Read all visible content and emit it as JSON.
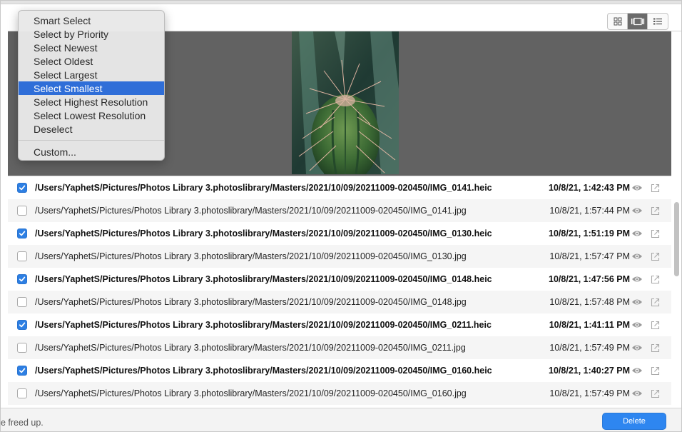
{
  "menu": {
    "items": [
      {
        "label": "Smart Select",
        "selected": false
      },
      {
        "label": "Select by Priority",
        "selected": false
      },
      {
        "label": "Select Newest",
        "selected": false
      },
      {
        "label": "Select Oldest",
        "selected": false
      },
      {
        "label": "Select Largest",
        "selected": false
      },
      {
        "label": "Select Smallest",
        "selected": true
      },
      {
        "label": "Select Highest Resolution",
        "selected": false
      },
      {
        "label": "Select Lowest Resolution",
        "selected": false
      },
      {
        "label": "Deselect",
        "selected": false
      }
    ],
    "custom_label": "Custom..."
  },
  "view_modes": [
    {
      "icon": "grid-view-icon",
      "active": false
    },
    {
      "icon": "filmstrip-view-icon",
      "active": true
    },
    {
      "icon": "list-view-icon",
      "active": false
    }
  ],
  "files": [
    {
      "path": "/Users/YaphetS/Pictures/Photos Library 3.photoslibrary/Masters/2021/10/09/20211009-020450/IMG_0141.heic",
      "date": "10/8/21, 1:42:43 PM",
      "checked": true
    },
    {
      "path": "/Users/YaphetS/Pictures/Photos Library 3.photoslibrary/Masters/2021/10/09/20211009-020450/IMG_0141.jpg",
      "date": "10/8/21, 1:57:44 PM",
      "checked": false
    },
    {
      "path": "/Users/YaphetS/Pictures/Photos Library 3.photoslibrary/Masters/2021/10/09/20211009-020450/IMG_0130.heic",
      "date": "10/8/21, 1:51:19 PM",
      "checked": true
    },
    {
      "path": "/Users/YaphetS/Pictures/Photos Library 3.photoslibrary/Masters/2021/10/09/20211009-020450/IMG_0130.jpg",
      "date": "10/8/21, 1:57:47 PM",
      "checked": false
    },
    {
      "path": "/Users/YaphetS/Pictures/Photos Library 3.photoslibrary/Masters/2021/10/09/20211009-020450/IMG_0148.heic",
      "date": "10/8/21, 1:47:56 PM",
      "checked": true
    },
    {
      "path": "/Users/YaphetS/Pictures/Photos Library 3.photoslibrary/Masters/2021/10/09/20211009-020450/IMG_0148.jpg",
      "date": "10/8/21, 1:57:48 PM",
      "checked": false
    },
    {
      "path": "/Users/YaphetS/Pictures/Photos Library 3.photoslibrary/Masters/2021/10/09/20211009-020450/IMG_0211.heic",
      "date": "10/8/21, 1:41:11 PM",
      "checked": true
    },
    {
      "path": "/Users/YaphetS/Pictures/Photos Library 3.photoslibrary/Masters/2021/10/09/20211009-020450/IMG_0211.jpg",
      "date": "10/8/21, 1:57:49 PM",
      "checked": false
    },
    {
      "path": "/Users/YaphetS/Pictures/Photos Library 3.photoslibrary/Masters/2021/10/09/20211009-020450/IMG_0160.heic",
      "date": "10/8/21, 1:40:27 PM",
      "checked": true
    },
    {
      "path": "/Users/YaphetS/Pictures/Photos Library 3.photoslibrary/Masters/2021/10/09/20211009-020450/IMG_0160.jpg",
      "date": "10/8/21, 1:57:49 PM",
      "checked": false
    }
  ],
  "footer": {
    "status_text": "e freed up.",
    "delete_label": "Delete"
  },
  "colors": {
    "accent": "#2e86f0",
    "menu_highlight": "#2f6ed8",
    "preview_bg": "#626262"
  },
  "icons": {
    "row_preview": "eye-icon",
    "row_reveal": "open-external-icon",
    "menu": "more-options-icon"
  }
}
